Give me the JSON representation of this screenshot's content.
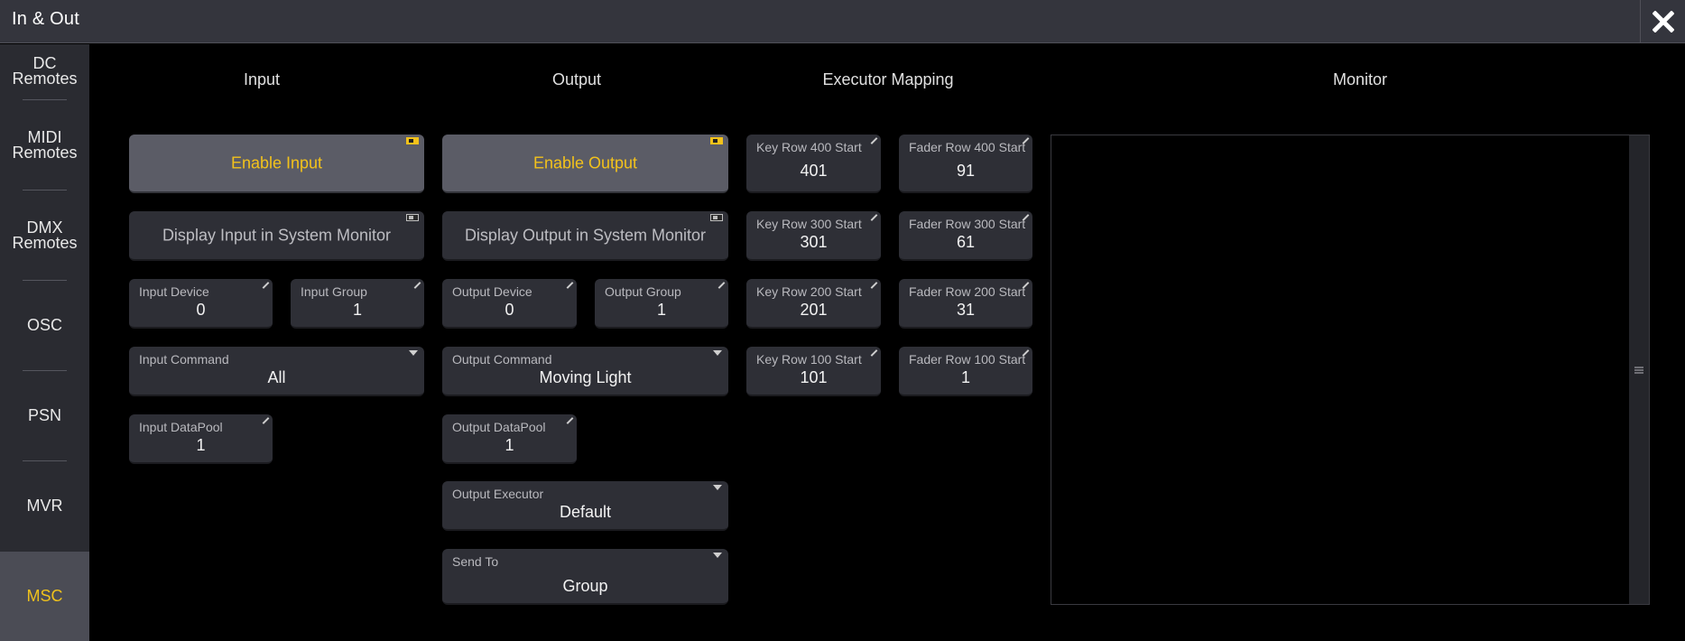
{
  "window": {
    "title": "In & Out",
    "close_icon": "close-icon"
  },
  "sidebar": {
    "items": [
      {
        "label": "DC\nRemotes",
        "active": false
      },
      {
        "label": "MIDI\nRemotes",
        "active": false
      },
      {
        "label": "DMX\nRemotes",
        "active": false
      },
      {
        "label": "OSC",
        "active": false
      },
      {
        "label": "PSN",
        "active": false
      },
      {
        "label": "MVR",
        "active": false
      },
      {
        "label": "MSC",
        "active": true
      }
    ]
  },
  "columns": {
    "input": "Input",
    "output": "Output",
    "executor_mapping": "Executor Mapping",
    "monitor": "Monitor"
  },
  "input": {
    "enable_label": "Enable Input",
    "display_label": "Display Input in System Monitor",
    "device_label": "Input Device",
    "device_value": "0",
    "group_label": "Input Group",
    "group_value": "1",
    "command_label": "Input Command",
    "command_value": "All",
    "datapool_label": "Input DataPool",
    "datapool_value": "1"
  },
  "output": {
    "enable_label": "Enable Output",
    "display_label": "Display Output in System Monitor",
    "device_label": "Output Device",
    "device_value": "0",
    "group_label": "Output Group",
    "group_value": "1",
    "command_label": "Output Command",
    "command_value": "Moving Light",
    "datapool_label": "Output DataPool",
    "datapool_value": "1",
    "executor_label": "Output Executor",
    "executor_value": "Default",
    "sendto_label": "Send To",
    "sendto_value": "Group"
  },
  "mapping": {
    "key400_label": "Key Row 400 Start",
    "key400_value": "401",
    "key300_label": "Key Row 300 Start",
    "key300_value": "301",
    "key200_label": "Key Row 200 Start",
    "key200_value": "201",
    "key100_label": "Key Row 100 Start",
    "key100_value": "101",
    "fader400_label": "Fader Row 400 Start",
    "fader400_value": "91",
    "fader300_label": "Fader Row 300 Start",
    "fader300_value": "61",
    "fader200_label": "Fader Row 200 Start",
    "fader200_value": "31",
    "fader100_label": "Fader Row 100 Start",
    "fader100_value": "1"
  },
  "colors": {
    "accent": "#f3c21b",
    "sidebar_bg": "#2a2b31",
    "titlebar_bg": "#34353d",
    "button_bg": "#2e2f36",
    "button_lit_bg": "#5b5c66"
  }
}
